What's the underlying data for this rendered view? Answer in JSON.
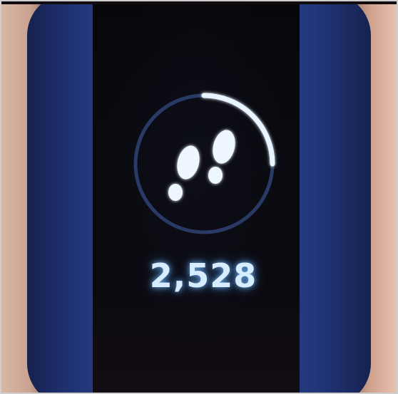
{
  "tracker": {
    "steps": "2,528",
    "progress_fraction": 0.25,
    "icon": "footprints-icon",
    "colors": {
      "band": "#1f3170",
      "screen": "#08080c",
      "glow": "#d6ecff",
      "ring_track": "#2a3a66"
    }
  }
}
